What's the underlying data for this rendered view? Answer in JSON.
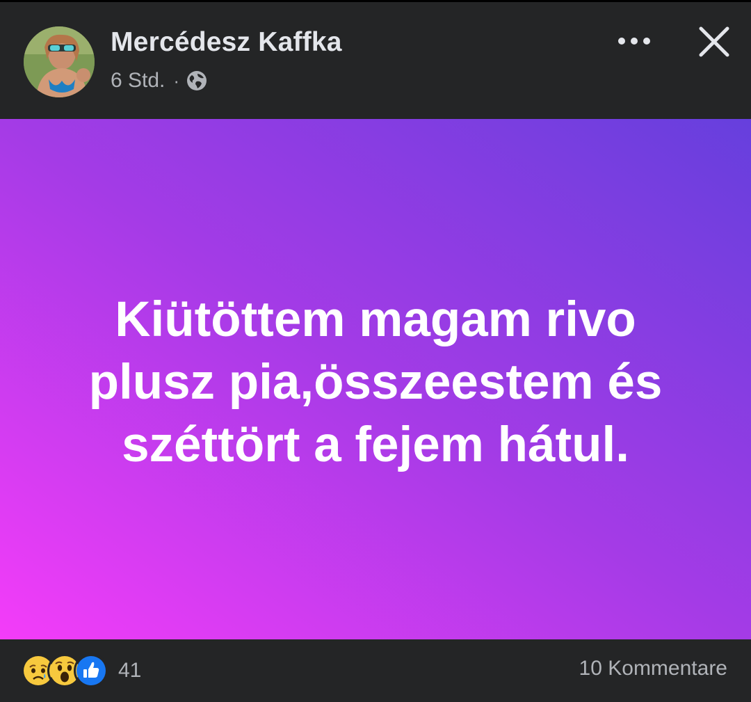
{
  "post": {
    "author_name": "Mercédesz Kaffka",
    "timestamp": "6 Std.",
    "separator": "·",
    "audience_icon": "globe-icon",
    "text": "Kiütöttem magam rivo plusz pia,összeestem és széttört a fejem hátul.",
    "background_gradient": [
      "#f43cf9",
      "#a43be6",
      "#663fdd"
    ]
  },
  "header_actions": {
    "more_icon": "more-horizontal-icon",
    "close_icon": "close-icon"
  },
  "footer": {
    "reactions": [
      "sad-reaction-icon",
      "wow-reaction-icon",
      "like-reaction-icon"
    ],
    "reaction_count": "41",
    "comments_label": "10 Kommentare"
  },
  "colors": {
    "background": "#242526",
    "primary_text": "#e4e6eb",
    "secondary_text": "#b0b3b8",
    "like_blue": "#1877f2"
  }
}
